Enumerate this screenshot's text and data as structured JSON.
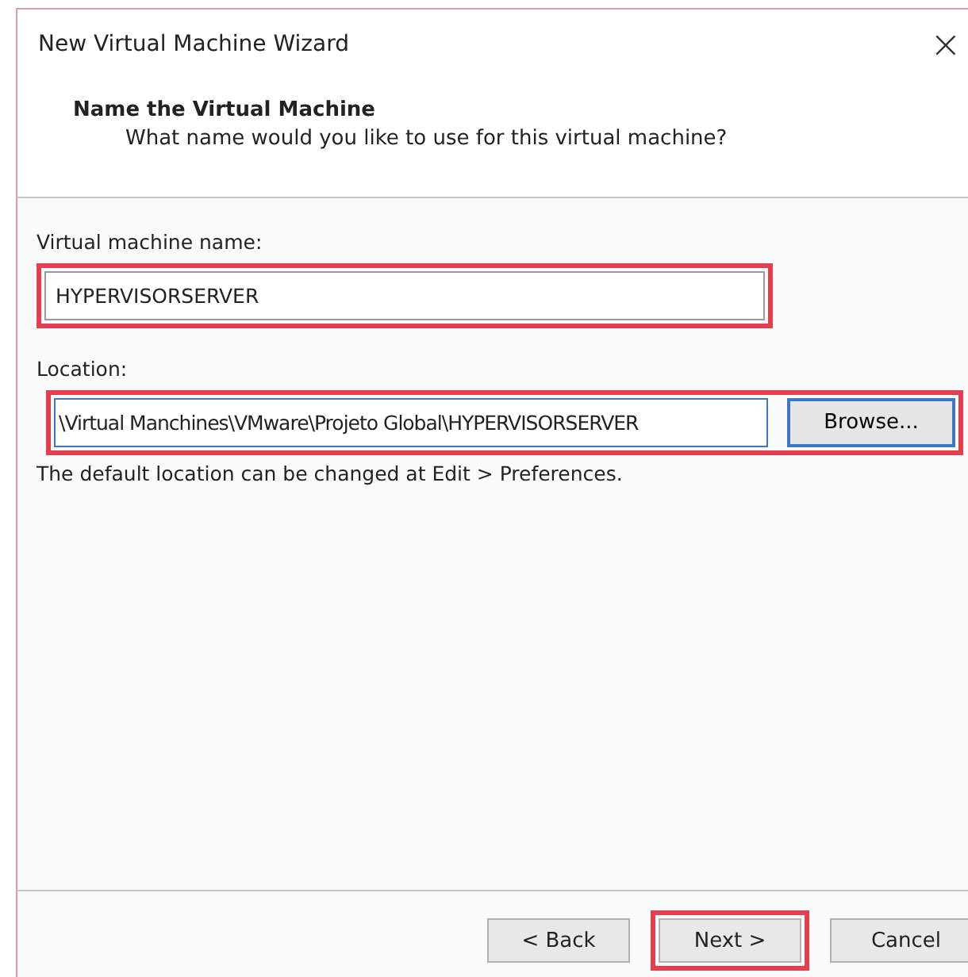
{
  "window": {
    "title": "New Virtual Machine Wizard",
    "close": "×"
  },
  "header": {
    "title": "Name the Virtual Machine",
    "subtitle": "What name would you like to use for this virtual machine?"
  },
  "name_field": {
    "label": "Virtual machine name:",
    "value": "HYPERVISORSERVER",
    "highlighted": true
  },
  "location_field": {
    "label": "Location:",
    "value": "\\Virtual Manchines\\VMware\\Projeto Global\\HYPERVISORSERVER",
    "browse": "Browse...",
    "highlighted": true
  },
  "hint": "The default location can be changed at Edit > Preferences.",
  "buttons": [
    {
      "label": "< Back",
      "highlighted": false
    },
    {
      "label": "Next >",
      "highlighted": true
    },
    {
      "label": "Cancel",
      "highlighted": false
    }
  ]
}
